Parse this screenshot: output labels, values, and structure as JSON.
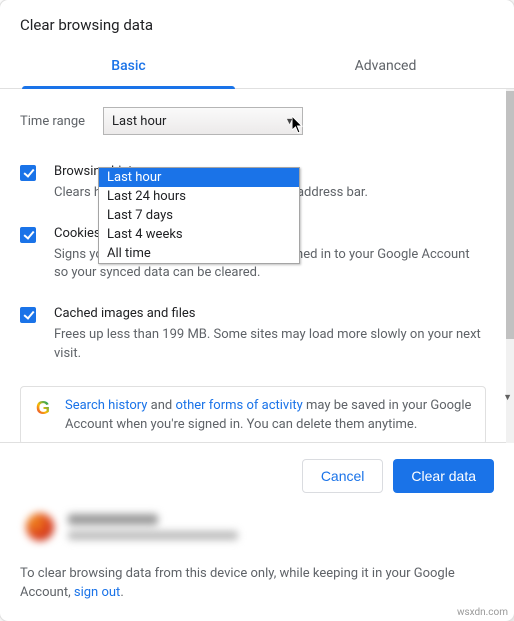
{
  "header": {
    "title": "Clear browsing data"
  },
  "tabs": {
    "basic": "Basic",
    "advanced": "Advanced"
  },
  "time": {
    "label": "Time range",
    "selected": "Last hour",
    "options": [
      "Last hour",
      "Last 24 hours",
      "Last 7 days",
      "Last 4 weeks",
      "All time"
    ]
  },
  "items": [
    {
      "title": "Browsing history",
      "desc": "Clears history and autocompletions in the address bar."
    },
    {
      "title": "Cookies and other site data",
      "desc": "Signs you out of most sites. You'll stay signed in to your Google Account so your synced data can be cleared."
    },
    {
      "title": "Cached images and files",
      "desc": "Frees up less than 199 MB. Some sites may load more slowly on your next visit."
    }
  ],
  "info": {
    "link1": "Search history",
    "mid1": " and ",
    "link2": "other forms of activity",
    "tail": " may be saved in your Google Account when you're signed in. You can delete them anytime."
  },
  "buttons": {
    "cancel": "Cancel",
    "clear": "Clear data"
  },
  "footer": {
    "pre": "To clear browsing data from this device only, while keeping it in your Google Account, ",
    "link": "sign out",
    "post": "."
  },
  "watermark": "wsxdn.com"
}
